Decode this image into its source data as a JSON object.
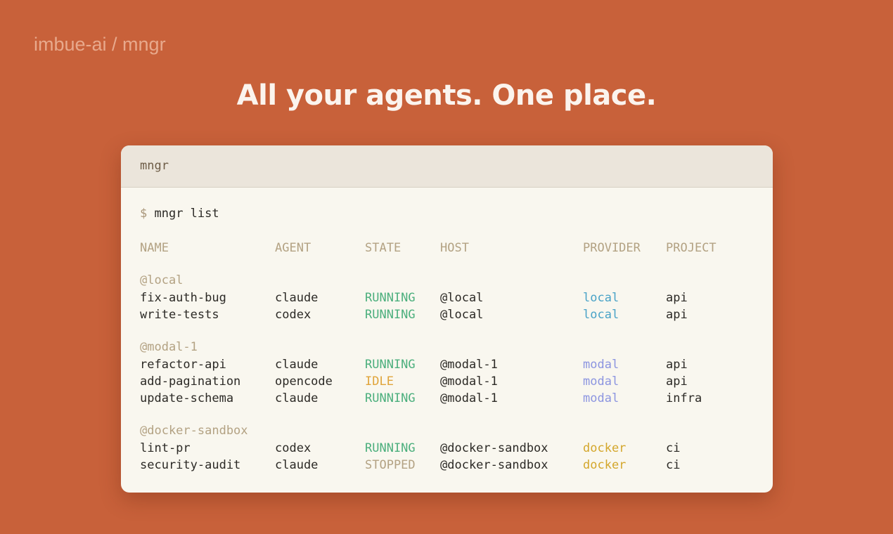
{
  "brand": "imbue-ai / mngr",
  "headline": "All your agents. One place.",
  "terminal": {
    "title": "mngr",
    "prompt_symbol": "$",
    "command": "mngr list",
    "columns": [
      "NAME",
      "AGENT",
      "STATE",
      "HOST",
      "PROVIDER",
      "PROJECT"
    ],
    "groups": [
      {
        "label": "@local",
        "rows": [
          {
            "name": "fix-auth-bug",
            "agent": "claude",
            "state": "RUNNING",
            "host": "@local",
            "provider": "local",
            "project": "api"
          },
          {
            "name": "write-tests",
            "agent": "codex",
            "state": "RUNNING",
            "host": "@local",
            "provider": "local",
            "project": "api"
          }
        ]
      },
      {
        "label": "@modal-1",
        "rows": [
          {
            "name": "refactor-api",
            "agent": "claude",
            "state": "RUNNING",
            "host": "@modal-1",
            "provider": "modal",
            "project": "api"
          },
          {
            "name": "add-pagination",
            "agent": "opencode",
            "state": "IDLE",
            "host": "@modal-1",
            "provider": "modal",
            "project": "api"
          },
          {
            "name": "update-schema",
            "agent": "claude",
            "state": "RUNNING",
            "host": "@modal-1",
            "provider": "modal",
            "project": "infra"
          }
        ]
      },
      {
        "label": "@docker-sandbox",
        "rows": [
          {
            "name": "lint-pr",
            "agent": "codex",
            "state": "RUNNING",
            "host": "@docker-sandbox",
            "provider": "docker",
            "project": "ci"
          },
          {
            "name": "security-audit",
            "agent": "claude",
            "state": "STOPPED",
            "host": "@docker-sandbox",
            "provider": "docker",
            "project": "ci"
          }
        ]
      }
    ]
  },
  "colors": {
    "background": "#c8613a",
    "state": {
      "RUNNING": "#4caf7d",
      "IDLE": "#e0a43a",
      "STOPPED": "#b3a283"
    },
    "provider": {
      "local": "#4aa3c7",
      "modal": "#8c95e0",
      "docker": "#d4a72c"
    }
  }
}
